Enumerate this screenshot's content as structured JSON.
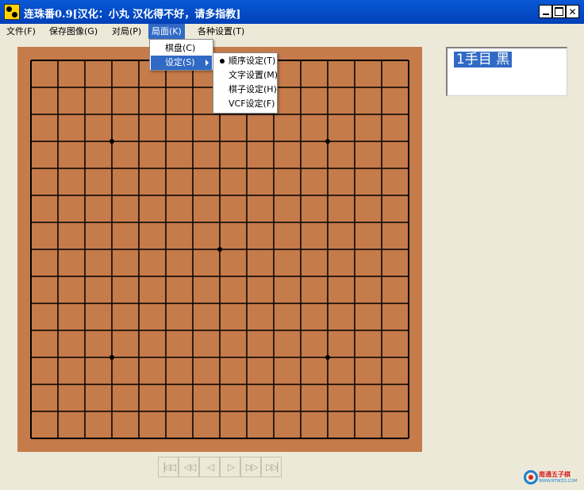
{
  "window": {
    "title": "连珠番0.9[汉化：小丸 汉化得不好，请多指教]"
  },
  "menubar": {
    "items": [
      {
        "label": "文件(F)"
      },
      {
        "label": "保存图像(G)"
      },
      {
        "label": "对局(P)"
      },
      {
        "label": "局面(K)"
      },
      {
        "label": "各种设置(T)"
      }
    ]
  },
  "board_menu": {
    "items": [
      {
        "label": "棋盘(C)"
      },
      {
        "label": "设定(S)"
      }
    ]
  },
  "settings_submenu": {
    "items": [
      {
        "label": "顺序设定(T)",
        "checked": true
      },
      {
        "label": "文字设置(M)"
      },
      {
        "label": "棋子设定(H)"
      },
      {
        "label": "VCF设定(F)"
      }
    ]
  },
  "board": {
    "size": 15,
    "star_points": [
      [
        3,
        3
      ],
      [
        11,
        3
      ],
      [
        7,
        7
      ],
      [
        3,
        11
      ],
      [
        11,
        11
      ]
    ],
    "colors": {
      "wood": "#c57b4a",
      "line": "#000000"
    }
  },
  "move_list": {
    "entries": [
      "1手目 黑"
    ]
  },
  "navigation": {
    "buttons": [
      {
        "icon": "first-icon",
        "glyph": "|◁◁"
      },
      {
        "icon": "rewind-icon",
        "glyph": "◁◁"
      },
      {
        "icon": "prev-icon",
        "glyph": "◁"
      },
      {
        "icon": "next-icon",
        "glyph": "▷"
      },
      {
        "icon": "forward-icon",
        "glyph": "▷▷"
      },
      {
        "icon": "last-icon",
        "glyph": "▷▷|"
      }
    ]
  },
  "watermark": {
    "text": "南通五子棋",
    "sub": "WWW.NTWZQ.COM"
  },
  "colors": {
    "titlebar": "#0a58d6",
    "highlight": "#316ac5",
    "background": "#ece9d8"
  }
}
